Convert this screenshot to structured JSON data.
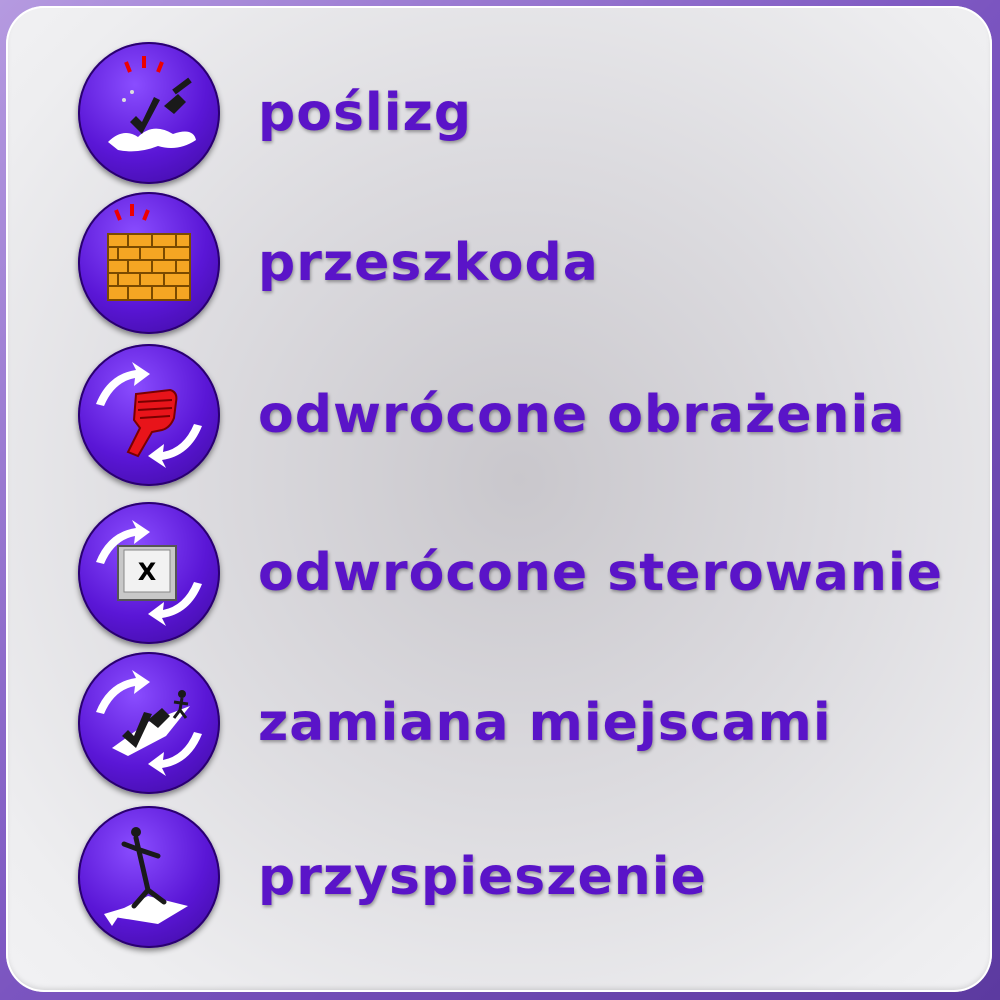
{
  "items": [
    {
      "icon": "skid-icon",
      "label": "poślizg"
    },
    {
      "icon": "brick-wall-icon",
      "label": "przeszkoda"
    },
    {
      "icon": "reversed-fist-icon",
      "label": "odwrócone obrażenia"
    },
    {
      "icon": "reversed-key-icon",
      "label": "odwrócone sterowanie"
    },
    {
      "icon": "swap-places-icon",
      "label": "zamiana miejscami"
    },
    {
      "icon": "sprint-icon",
      "label": "przyspieszenie"
    }
  ],
  "colors": {
    "label": "#5a14c8",
    "badge": "#5a16d6",
    "frame": "#7b55c0",
    "panel": "#e2e1e5"
  }
}
